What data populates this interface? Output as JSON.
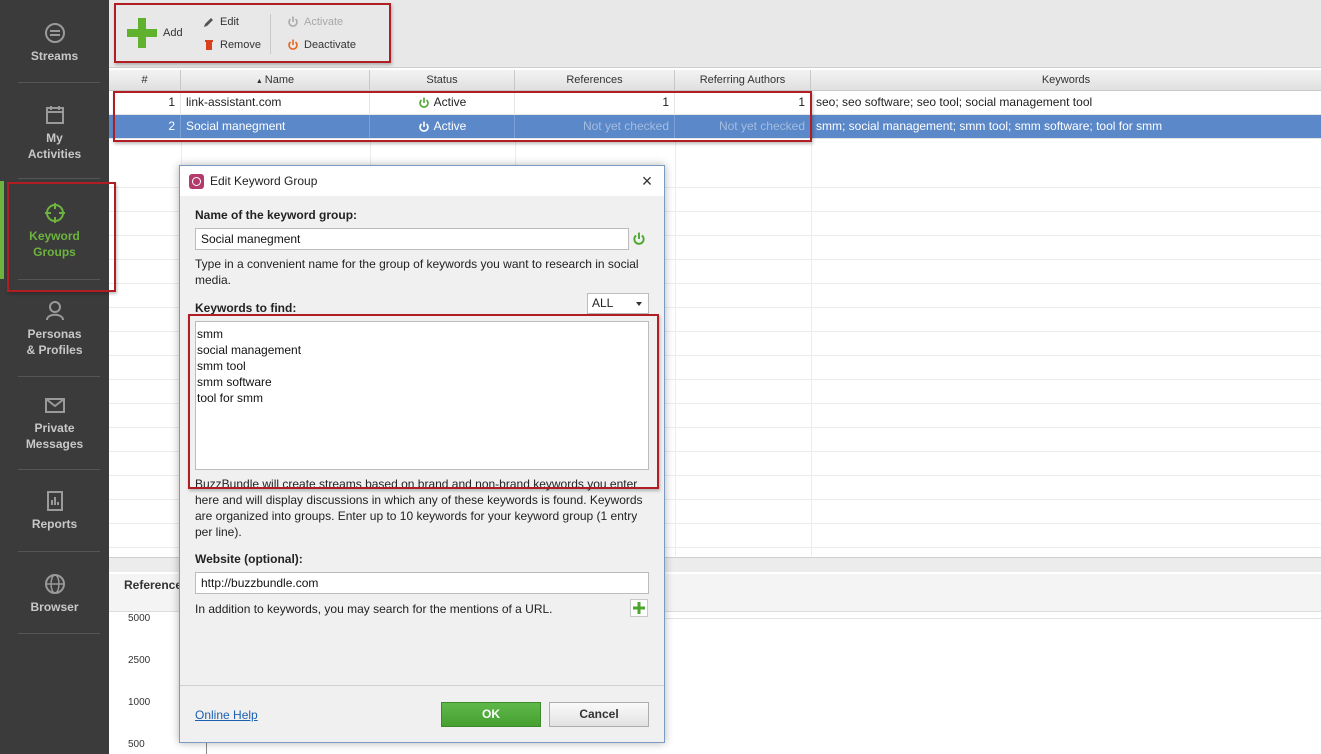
{
  "sidebar": {
    "items": [
      {
        "label": "Streams",
        "icon": "streams-icon"
      },
      {
        "label": "My\nActivities",
        "label1": "My",
        "label2": "Activities",
        "icon": "calendar-icon"
      },
      {
        "label1": "Keyword",
        "label2": "Groups",
        "icon": "crosshair-icon",
        "active": true
      },
      {
        "label1": "Personas",
        "label2": "& Profiles",
        "icon": "person-icon"
      },
      {
        "label1": "Private",
        "label2": "Messages",
        "icon": "envelope-icon"
      },
      {
        "label1": "Reports",
        "icon": "report-icon"
      },
      {
        "label1": "Browser",
        "icon": "globe-icon"
      }
    ],
    "active_color": "#6db33f"
  },
  "toolbar": {
    "add_label": "Add",
    "edit_label": "Edit",
    "remove_label": "Remove",
    "activate_label": "Activate",
    "deactivate_label": "Deactivate"
  },
  "table": {
    "headers": [
      "#",
      "Name",
      "Status",
      "References",
      "Referring Authors",
      "Keywords"
    ],
    "rows": [
      {
        "num": "1",
        "name": "link-assistant.com",
        "status": "Active",
        "references": "1",
        "authors": "1",
        "keywords": "seo; seo software; seo tool; social management tool"
      },
      {
        "num": "2",
        "name": "Social manegment",
        "status": "Active",
        "references": "Not yet checked",
        "authors": "Not yet checked",
        "keywords": "smm; social management; smm tool; smm software; tool for smm",
        "selected": true
      }
    ]
  },
  "bottom_panel": {
    "title": "Reference",
    "axis": [
      "5000",
      "2500",
      "1000",
      "500"
    ]
  },
  "dialog": {
    "title": "Edit Keyword Group",
    "name_label": "Name of the keyword group:",
    "name_value": "Social manegment",
    "name_help": "Type in a convenient name for the group of keywords you want to research in social media.",
    "keywords_label": "Keywords to find:",
    "filter_value": "ALL",
    "keywords": [
      "smm",
      "social management",
      "smm tool",
      "smm software",
      "tool for smm"
    ],
    "keywords_help": "BuzzBundle will create streams based on brand and non-brand keywords you enter here and will display discussions in which any of these keywords is found. Keywords are organized into groups. Enter up to 10 keywords for your keyword group (1 entry per line).",
    "website_label": "Website (optional):",
    "website_value": "http://buzzbundle.com",
    "website_help": "In addition to keywords, you may search for the mentions of a URL.",
    "help_link": "Online Help",
    "ok_label": "OK",
    "cancel_label": "Cancel"
  },
  "colors": {
    "highlight": "#b01e23",
    "selection": "#5b88c8",
    "ok_green": "#46a030",
    "deactivate_orange": "#e8641b"
  }
}
